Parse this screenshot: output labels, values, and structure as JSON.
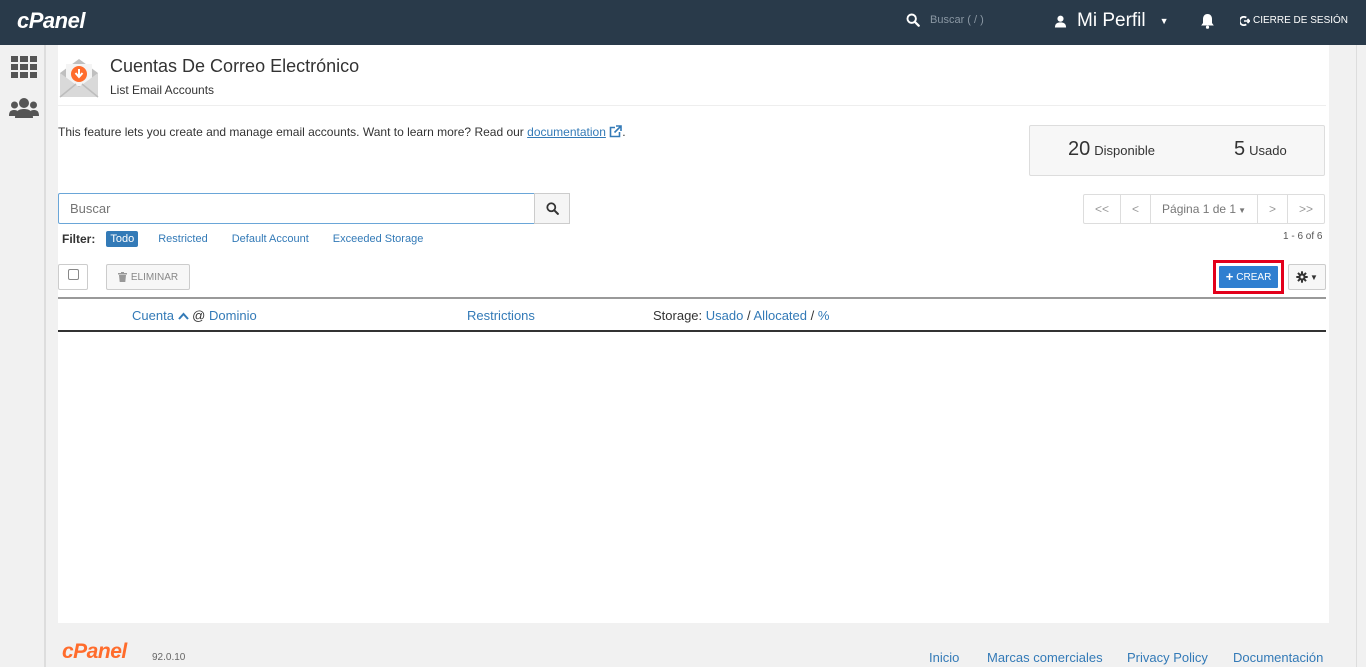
{
  "topbar": {
    "logo": "cPanel",
    "search_placeholder": "Buscar ( / )",
    "profile_label": "Mi Perfil",
    "logout_label": "CIERRE DE SESIÓN"
  },
  "page": {
    "title": "Cuentas De Correo Electrónico",
    "subtitle": "List Email Accounts",
    "intro_text": "This feature lets you create and manage email accounts. Want to learn more? Read our ",
    "intro_link": "documentation",
    "intro_end": "."
  },
  "stats": {
    "available_num": "20",
    "available_label": "Disponible",
    "used_num": "5",
    "used_label": "Usado"
  },
  "search": {
    "placeholder": "Buscar"
  },
  "pagination": {
    "first": "<<",
    "prev": "<",
    "page_label": "Página 1 de 1",
    "next": ">",
    "last": ">>",
    "range": "1 - 6 of 6"
  },
  "filter": {
    "label": "Filter:",
    "options": [
      "Todo",
      "Restricted",
      "Default Account",
      "Exceeded Storage"
    ]
  },
  "toolbar": {
    "delete_label": "ELIMINAR",
    "create_label": "CREAR"
  },
  "table": {
    "col_account": "Cuenta",
    "col_at": "@",
    "col_domain": "Dominio",
    "col_restrictions": "Restrictions",
    "col_storage": "Storage:",
    "col_used": "Usado",
    "col_allocated": "Allocated",
    "col_percent": "%",
    "slash": "/"
  },
  "footer": {
    "logo": "cPanel",
    "version": "92.0.10",
    "links": [
      "Inicio",
      "Marcas comerciales",
      "Privacy Policy",
      "Documentación"
    ]
  },
  "colors": {
    "topbar": "#293a4a",
    "link": "#337ab7",
    "primary_button": "#2f7fd0",
    "highlight": "#e3001b",
    "brand_orange": "#ff6c2c"
  }
}
